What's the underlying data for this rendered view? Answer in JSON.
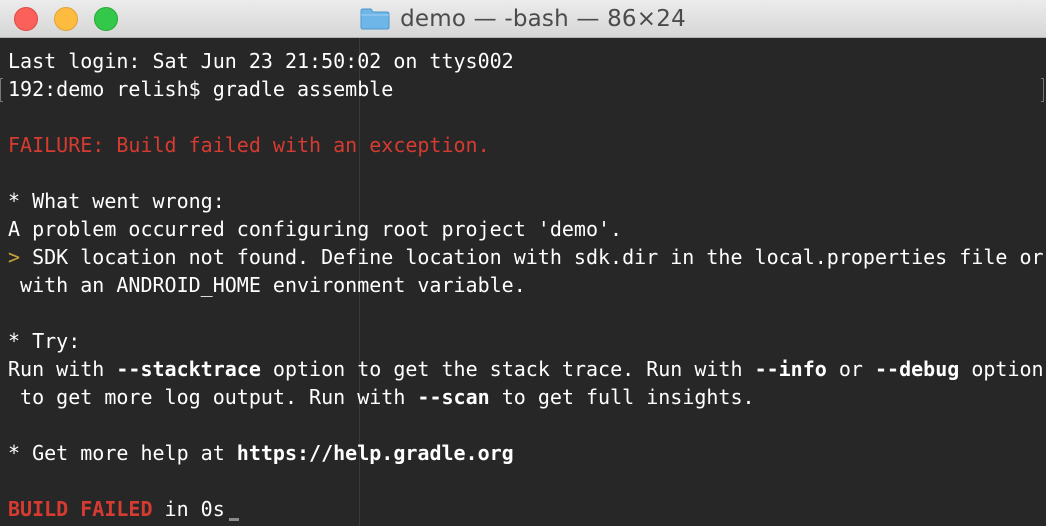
{
  "window": {
    "title": "demo — -bash — 86×24"
  },
  "terminal": {
    "line1": "Last login: Sat Jun 23 21:50:02 on ttys002",
    "prompt": "192:demo relish$ gradle assemble",
    "failure": "FAILURE: Build failed with an exception.",
    "wrong_head": "* What went wrong:",
    "wrong_1": "A problem occurred configuring root project 'demo'.",
    "wrong_marker": ">",
    "wrong_2": " SDK location not found. Define location with sdk.dir in the local.properties file or",
    "wrong_3": " with an ANDROID_HOME environment variable.",
    "try_head": "* Try:",
    "try_a": "Run with ",
    "try_stacktrace": "--stacktrace",
    "try_b": " option to get the stack trace. Run with ",
    "try_info": "--info",
    "try_c": " or ",
    "try_debug": "--debug",
    "try_d": " option",
    "try2_a": " to get more log output. Run with ",
    "try2_scan": "--scan",
    "try2_b": " to get full insights.",
    "help_a": "* Get more help at ",
    "help_url": "https://help.gradle.org",
    "build_failed": "BUILD FAILED",
    "build_time": " in 0s"
  },
  "icons": {
    "title_icon": "folder-icon",
    "cursor": "text-cursor"
  },
  "colors": {
    "background": "#272727",
    "text": "#ffffff",
    "error": "#d63b31",
    "marker": "#c9a23a"
  }
}
